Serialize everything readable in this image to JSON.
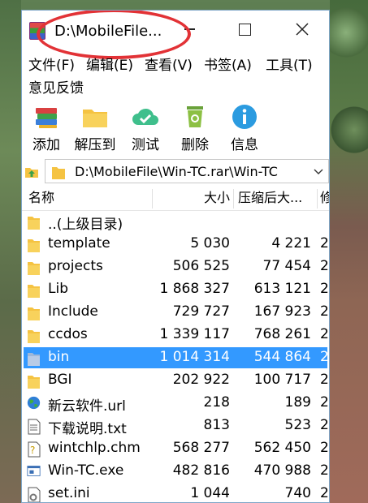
{
  "window": {
    "title": "D:\\MobileFile..."
  },
  "menu": [
    "文件(F)",
    "编辑(E)",
    "查看(V)",
    "书签(A)",
    "工具(T)",
    "意见反馈"
  ],
  "toolbar": [
    {
      "label": "添加",
      "icon": "books-icon"
    },
    {
      "label": "解压到",
      "icon": "folder-icon"
    },
    {
      "label": "测试",
      "icon": "cloud-check-icon"
    },
    {
      "label": "删除",
      "icon": "recycle-bin-icon"
    },
    {
      "label": "信息",
      "icon": "info-icon"
    }
  ],
  "address": {
    "path": "D:\\MobileFile\\Win-TC.rar\\Win-TC"
  },
  "columns": {
    "name": "名称",
    "size": "大小",
    "packed": "压缩后大...",
    "modified": "修"
  },
  "files": [
    {
      "name": "..(上级目录)",
      "size": "",
      "packed": "",
      "mod": "",
      "icon": "folder-icon"
    },
    {
      "name": "template",
      "size": "5 030",
      "packed": "4 221",
      "mod": "2",
      "icon": "folder-icon"
    },
    {
      "name": "projects",
      "size": "506 525",
      "packed": "77 454",
      "mod": "2",
      "icon": "folder-icon"
    },
    {
      "name": "Lib",
      "size": "1 868 327",
      "packed": "613 121",
      "mod": "2",
      "icon": "folder-icon"
    },
    {
      "name": "Include",
      "size": "729 727",
      "packed": "167 923",
      "mod": "2",
      "icon": "folder-icon"
    },
    {
      "name": "ccdos",
      "size": "1 339 117",
      "packed": "768 261",
      "mod": "2",
      "icon": "folder-icon"
    },
    {
      "name": "bin",
      "size": "1 014 314",
      "packed": "544 864",
      "mod": "2",
      "icon": "folder-icon"
    },
    {
      "name": "BGI",
      "size": "202 922",
      "packed": "100 717",
      "mod": "2",
      "icon": "folder-icon"
    },
    {
      "name": "新云软件.url",
      "size": "218",
      "packed": "189",
      "mod": "2",
      "icon": "globe-icon"
    },
    {
      "name": "下载说明.txt",
      "size": "813",
      "packed": "523",
      "mod": "2",
      "icon": "text-file-icon"
    },
    {
      "name": "wintchlp.chm",
      "size": "568 277",
      "packed": "562 450",
      "mod": "2",
      "icon": "help-file-icon"
    },
    {
      "name": "Win-TC.exe",
      "size": "482 816",
      "packed": "470 988",
      "mod": "2",
      "icon": "exe-file-icon"
    },
    {
      "name": "set.ini",
      "size": "1 044",
      "packed": "740",
      "mod": "2",
      "icon": "settings-file-icon"
    }
  ],
  "selected_row": 6,
  "colors": {
    "selection": "#3399ff",
    "annotation": "#e23236",
    "folder": "#f5c342"
  }
}
